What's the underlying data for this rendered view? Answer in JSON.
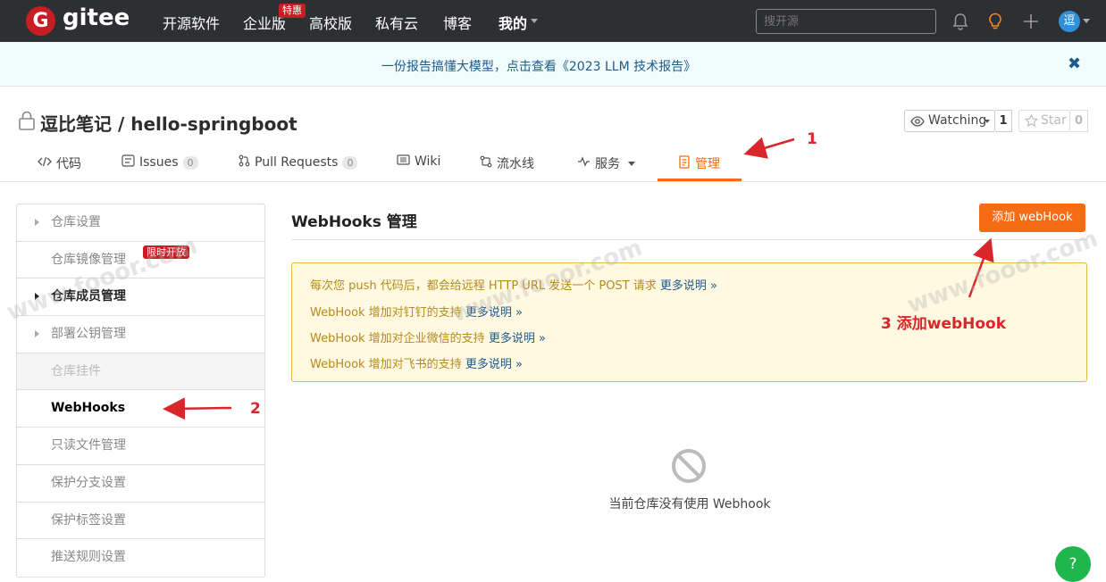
{
  "nav": {
    "logo_letter": "G",
    "logo_text": "gitee",
    "items": [
      {
        "label": "开源软件"
      },
      {
        "label": "企业版"
      },
      {
        "label": "高校版"
      },
      {
        "label": "私有云"
      },
      {
        "label": "博客"
      },
      {
        "label": "我的"
      }
    ],
    "enterprise_badge": "特惠",
    "search_placeholder": "搜开源",
    "avatar_text": "逗",
    "icons": [
      "bell-icon",
      "lightbulb-icon",
      "plus-icon"
    ]
  },
  "banner": {
    "text": "一份报告搞懂大模型，点击查看《2023 LLM 技术报告》",
    "close": "✖"
  },
  "repo": {
    "title": "逗比笔记 / hello-springboot",
    "watch_label": "Watching",
    "watch_count": "1",
    "star_label": "Star",
    "star_count": "0",
    "tabs": [
      {
        "label": "代码",
        "icon": "code-icon"
      },
      {
        "label": "Issues",
        "count": "0",
        "icon": "issues-icon"
      },
      {
        "label": "Pull Requests",
        "count": "0",
        "icon": "pull-request-icon"
      },
      {
        "label": "Wiki",
        "icon": "wiki-icon"
      },
      {
        "label": "流水线",
        "icon": "pipeline-icon"
      },
      {
        "label": "服务",
        "icon": "pulse-icon"
      },
      {
        "label": "管理",
        "icon": "manage-icon",
        "active": true
      }
    ]
  },
  "sidebar": {
    "items": [
      {
        "label": "仓库设置"
      },
      {
        "label": "仓库镜像管理",
        "badge": "限时开放"
      },
      {
        "label": "仓库成员管理"
      },
      {
        "label": "部署公钥管理"
      },
      {
        "label": "仓库挂件"
      },
      {
        "label": "WebHooks"
      },
      {
        "label": "只读文件管理"
      },
      {
        "label": "保护分支设置"
      },
      {
        "label": "保护标签设置"
      },
      {
        "label": "推送规则设置"
      }
    ]
  },
  "main": {
    "title": "WebHooks 管理",
    "add_button": "添加 webHook",
    "notice": [
      {
        "text": "每次您 push 代码后，都会给远程 HTTP URL 发送一个 POST 请求 ",
        "link": "更多说明 »"
      },
      {
        "text": "WebHook 增加对钉钉的支持 ",
        "link": "更多说明 »"
      },
      {
        "text": "WebHook 增加对企业微信的支持 ",
        "link": "更多说明 »"
      },
      {
        "text": "WebHook 增加对飞书的支持 ",
        "link": "更多说明 »"
      }
    ],
    "empty_text": "当前仓库没有使用 Webhook"
  },
  "annotations": {
    "one": "1",
    "two": "2",
    "three": "3 添加webHook"
  },
  "watermark": "www.fooor.com",
  "help": "?",
  "colors": {
    "brand": "#c71d23",
    "accent": "#f56c14",
    "nav_bg": "#2e2f33",
    "annotation": "#d9262a"
  }
}
